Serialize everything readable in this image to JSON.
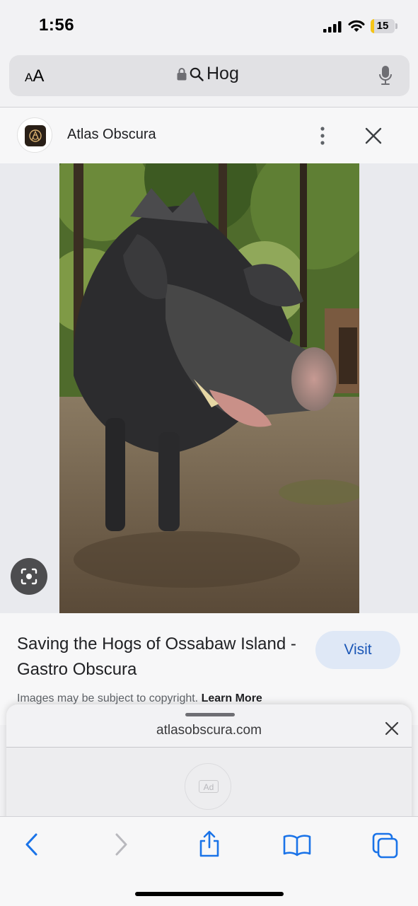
{
  "status_bar": {
    "time": "1:56",
    "battery_level": "15",
    "battery_fraction": 0.15
  },
  "address_bar": {
    "text_size_label_small": "A",
    "text_size_label_large": "A",
    "query": "Hog"
  },
  "result_header": {
    "site_name": "Atlas Obscura"
  },
  "result": {
    "title": "Saving the Hogs of Ossabaw Island - Gastro Obscura",
    "visit_label": "Visit",
    "copyright_notice": "Images may be subject to copyright.",
    "learn_more_label": "Learn More"
  },
  "bottom_sheet": {
    "domain": "atlasobscura.com",
    "ad_label": "Ad"
  },
  "colors": {
    "accent": "#1a73e8",
    "visit_bg": "#dfe8f6",
    "battery": "#f5c518"
  },
  "icons": [
    "signal-icon",
    "wifi-icon",
    "battery-icon",
    "lock-icon",
    "search-icon",
    "microphone-icon",
    "more-vertical-icon",
    "close-icon",
    "lens-icon",
    "back-icon",
    "forward-icon",
    "share-icon",
    "bookmarks-icon",
    "tabs-icon"
  ]
}
